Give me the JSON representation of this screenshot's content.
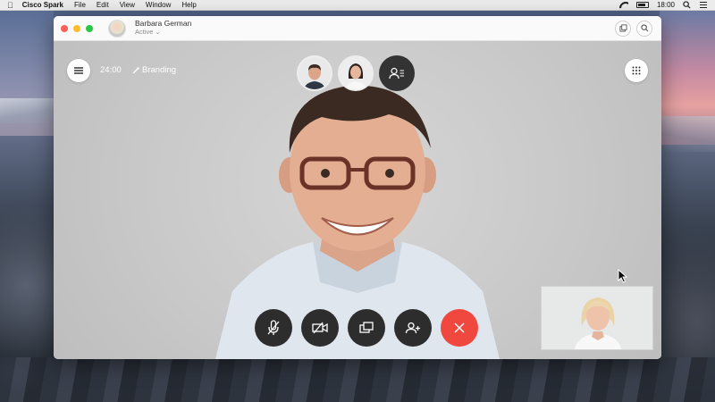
{
  "menubar": {
    "app_name": "Cisco Spark",
    "items": [
      "File",
      "Edit",
      "View",
      "Window",
      "Help"
    ],
    "clock": "18:00"
  },
  "window": {
    "contact": {
      "name": "Barbara German",
      "status": "Active"
    }
  },
  "call": {
    "duration": "24:00",
    "branding_label": "Branding",
    "participant_count_visible": 2
  },
  "colors": {
    "end_call": "#f0473f",
    "control_bg": "#2d2d2d",
    "traffic_red": "#fc5f57",
    "traffic_yellow": "#fdbc2e",
    "traffic_green": "#28c840"
  },
  "icons": {
    "menu": "hamburger-icon",
    "keypad": "keypad-icon",
    "mute": "microphone-muted-icon",
    "video": "camera-off-icon",
    "share": "share-screen-icon",
    "add": "add-person-icon",
    "end": "close-icon"
  }
}
